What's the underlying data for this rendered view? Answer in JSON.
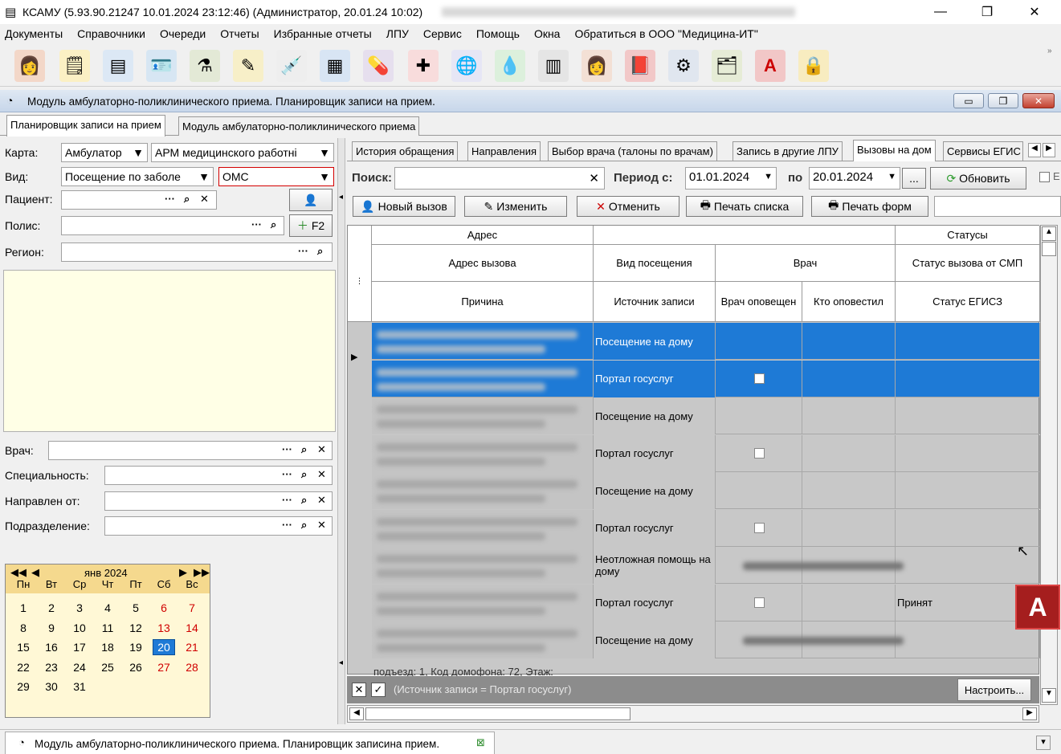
{
  "window": {
    "title": "КСАМУ (5.93.90.21247 10.01.2024 23:12:46) (Администратор, 20.01.24 10:02)",
    "minimize": "—",
    "restore": "❐",
    "close": "✕"
  },
  "menu": [
    "Документы",
    "Справочники",
    "Очереди",
    "Отчеты",
    "Избранные отчеты",
    "ЛПУ",
    "Сервис",
    "Помощь",
    "Окна",
    "Обратиться в ООО \"Медицина-ИТ\""
  ],
  "toolbar_icons": [
    "doctor-icon",
    "notepad-icon",
    "card-icon",
    "id-card-icon",
    "lab-flask-icon",
    "edit-icon",
    "syringe-icon",
    "calendar-icon",
    "pills-icon",
    "med-card-icon",
    "globe-icon",
    "droplet-icon",
    "scanner-icon",
    "nurse-icon",
    "book-icon",
    "settings-icon",
    "documents-icon",
    "letter-a-icon",
    "lock-icon"
  ],
  "module": {
    "title": "Модуль амбулаторно-поликлинического приема. Планировщик записи на прием."
  },
  "tabs": [
    "Планировщик записи на прием",
    "Модуль амбулаторно-поликлинического приема"
  ],
  "left": {
    "karta_label": "Карта:",
    "karta_value": "Амбулатор",
    "arm_value": "АРМ медицинского работні",
    "vid_label": "Вид:",
    "vid_value": "Посещение по заболе",
    "oms_value": "ОМС",
    "patient_label": "Пациент:",
    "polis_label": "Полис:",
    "f2_label": "F2",
    "region_label": "Регион:",
    "vrach_label": "Врач:",
    "spec_label": "Специальность:",
    "napr_label": "Направлен от:",
    "podr_label": "Подразделение:"
  },
  "calendar": {
    "month": "янв 2024",
    "weekdays": [
      "Пн",
      "Вт",
      "Ср",
      "Чт",
      "Пт",
      "Сб",
      "Вс"
    ],
    "weeks": [
      [
        "1",
        "2",
        "3",
        "4",
        "5",
        "6",
        "7"
      ],
      [
        "8",
        "9",
        "10",
        "11",
        "12",
        "13",
        "14"
      ],
      [
        "15",
        "16",
        "17",
        "18",
        "19",
        "20",
        "21"
      ],
      [
        "22",
        "23",
        "24",
        "25",
        "26",
        "27",
        "28"
      ],
      [
        "29",
        "30",
        "31",
        "",
        "",
        "",
        ""
      ]
    ],
    "today": "20"
  },
  "right_tabs": [
    "История обращения",
    "Направления",
    "Выбор врача (талоны по врачам)",
    "Запись в другие ЛПУ",
    "Вызовы на дом",
    "Сервисы ЕГИС"
  ],
  "search": {
    "label": "Поиск:",
    "period_label": "Период с:",
    "date_from": "01.01.2024",
    "to_label": "по",
    "date_to": "20.01.2024",
    "dots": "...",
    "refresh": "Обновить"
  },
  "actions": [
    "Новый вызов",
    "Изменить",
    "Отменить",
    "Печать списка",
    "Печать форм"
  ],
  "grid": {
    "band_address": "Адрес",
    "band_status": "Статусы",
    "col_address": "Адрес вызова",
    "col_reason": "Причина",
    "col_visit": "Вид посещения",
    "col_source": "Источник записи",
    "col_doctor": "Врач",
    "col_notified": "Врач оповещен",
    "col_who": "Кто оповестил",
    "col_smp": "Статус вызова от СМП",
    "col_egisz": "Статус ЕГИСЗ",
    "rows": [
      {
        "type": "Посещение на дому",
        "check": false,
        "status": ""
      },
      {
        "type": "Портал госуслуг",
        "check": true,
        "status": ""
      },
      {
        "type": "Посещение на дому",
        "check": false,
        "status": ""
      },
      {
        "type": "Портал госуслуг",
        "check": true,
        "status": ""
      },
      {
        "type": "Посещение на дому",
        "check": false,
        "status": ""
      },
      {
        "type": "Портал госуслуг",
        "check": true,
        "status": ""
      },
      {
        "type": "Неотложная помощь на дому",
        "check": false,
        "status": ""
      },
      {
        "type": "Портал госуслуг",
        "check": true,
        "status": "Принят"
      },
      {
        "type": "Посещение на дому",
        "check": false,
        "status": ""
      }
    ],
    "partial_text": "подъезд: 1, Код домофона: 72, Этаж:"
  },
  "filter": {
    "text": "(Источник записи = Портал госуслуг)",
    "configure": "Настроить..."
  },
  "bottom_tab": "Модуль амбулаторно-поликлинического приема. Планировщик записина прием."
}
